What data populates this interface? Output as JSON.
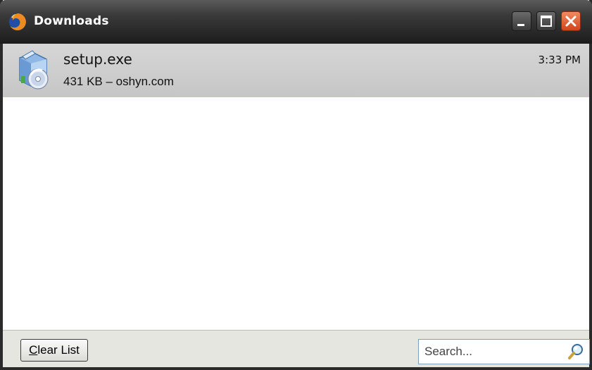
{
  "window": {
    "title": "Downloads",
    "icon": "firefox-icon"
  },
  "titlebar_buttons": {
    "minimize": "minimize-icon",
    "maximize": "maximize-icon",
    "close": "close-icon"
  },
  "downloads": [
    {
      "filename": "setup.exe",
      "status": "431 KB – oshyn.com",
      "time": "3:33 PM",
      "icon": "installer-icon"
    }
  ],
  "bottombar": {
    "clear_label_underlined": "C",
    "clear_label_rest": "lear List",
    "search_placeholder": "Search..."
  },
  "colors": {
    "titlebar": "#2a2a2a",
    "close_button": "#d2441c",
    "selected_item": "#cfcfcf"
  }
}
